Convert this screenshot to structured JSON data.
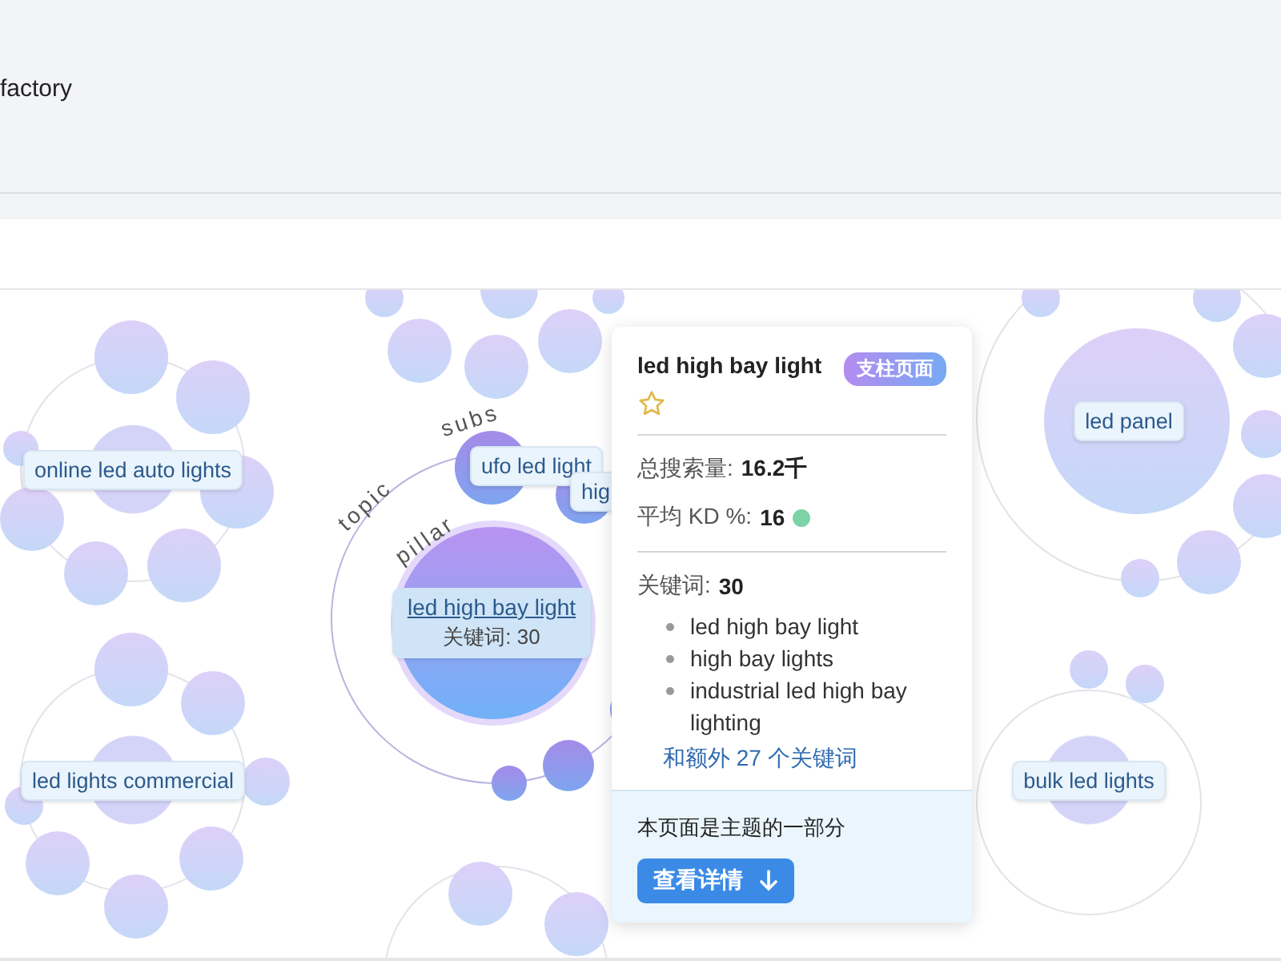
{
  "header": {
    "title": "factory"
  },
  "map": {
    "ring_labels": [
      "topic",
      "subs",
      "pillar"
    ],
    "clusters": [
      {
        "label": "online led auto lights"
      },
      {
        "label": "led lights commercial"
      },
      {
        "label": "led panel"
      },
      {
        "label": "bulk led lights"
      },
      {
        "label": "ufo led light"
      },
      {
        "label": "hig"
      }
    ],
    "pillar": {
      "title": "led high bay light",
      "keywords": "关键词: 30"
    }
  },
  "popup": {
    "title": "led high bay light",
    "badge": "支柱页面",
    "starred": false,
    "stats": [
      {
        "label": "总搜索量:",
        "value": "16.2千"
      },
      {
        "label": "平均 KD %:",
        "value": "16",
        "color": "#7dd3a8"
      }
    ],
    "keywords_label": "关键词:",
    "keywords_count": "30",
    "keywords": [
      "led high bay light",
      "high bay lights",
      "industrial led high bay lighting"
    ],
    "more_link": "和额外 27 个关键词",
    "footer_text": "本页面是主题的一部分",
    "button": "查看详情"
  }
}
